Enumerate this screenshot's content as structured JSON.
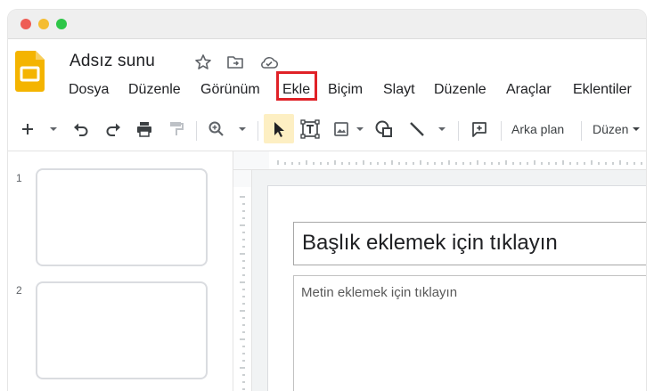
{
  "document": {
    "title": "Adsız sunu"
  },
  "menu": {
    "items": [
      "Dosya",
      "Düzenle",
      "Görünüm",
      "Ekle",
      "Biçim",
      "Slayt",
      "Düzenle",
      "Araçlar",
      "Eklentiler"
    ],
    "highlighted": "Ekle",
    "highlight_color": "#e02127"
  },
  "toolbar": {
    "background_label": "Arka plan",
    "layout_label": "Düzen",
    "icons": [
      "plus-icon",
      "undo-icon",
      "redo-icon",
      "print-icon",
      "paint-format-icon",
      "zoom-icon",
      "select-cursor-icon",
      "text-box-icon",
      "image-icon",
      "shape-icon",
      "line-icon",
      "comment-icon"
    ],
    "active_tool": "select-cursor-icon"
  },
  "filmstrip": {
    "slides": [
      {
        "number": "1"
      },
      {
        "number": "2"
      }
    ]
  },
  "slide": {
    "title_placeholder": "Başlık eklemek için tıklayın",
    "body_placeholder": "Metin eklemek için tıklayın"
  },
  "colors": {
    "logo": "#f4b400",
    "active_tool_bg": "#fdefc3",
    "icon": "#5f6368"
  }
}
